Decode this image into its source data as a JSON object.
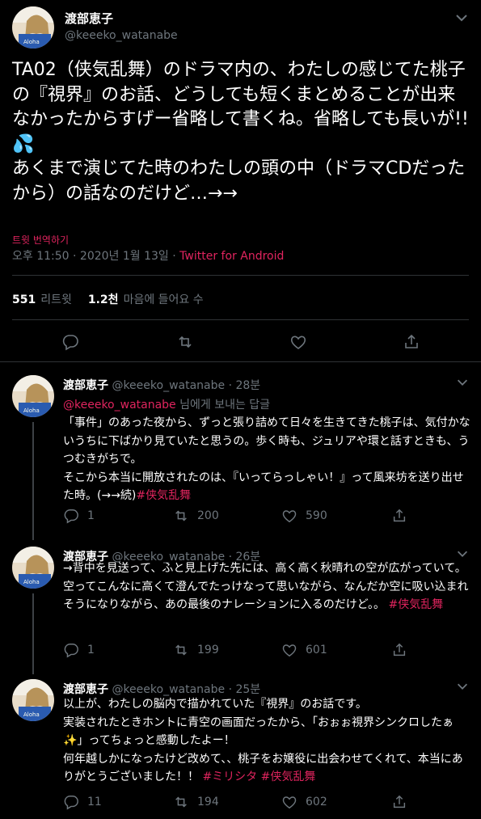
{
  "colors": {
    "accent": "#e0245e",
    "muted": "#6e767d",
    "divider": "#2f3336",
    "background": "#000000"
  },
  "main": {
    "author": "渡部恵子",
    "handle": "@keeeko_watanabe",
    "body": "TA02（侠気乱舞）のドラマ内の、わたしの感じてた桃子の『視界』のお話、どうしても短くまとめることが出来なかったからすげー省略して書くね。省略しても長いが!!💦\nあくまで演じてた時のわたしの頭の中（ドラマCDだったから）の話なのだけど…→→",
    "translate": "트윗 번역하기",
    "datetime": "오후 11:50 · 2020년 1월 13일",
    "sep": " · ",
    "source": "Twitter for Android",
    "retweets_count": "551",
    "retweets_label": "리트윗",
    "likes_count": "1.2천",
    "likes_label": "마음에 들어요 수",
    "icons": [
      "reply-icon",
      "retweet-icon",
      "like-icon",
      "share-icon"
    ]
  },
  "replies": [
    {
      "author": "渡部恵子",
      "handle": "@keeeko_watanabe · 28분",
      "replying_handle": "@keeeko_watanabe",
      "replying_suffix": " 님에게 보내는 답글",
      "text": "「事件」のあった夜から、ずっと張り詰めて日々を生きてきた桃子は、気付かないうちに下ばかり見ていたと思うの。歩く時も、ジュリアや環と話すときも、うつむきがちで。\nそこから本当に開放されたのは、『いってらっしゃい！』って風来坊を送り出せた時。(→→続)",
      "hashtags": "#侠気乱舞",
      "reply_count": "1",
      "retweet_count": "200",
      "like_count": "590"
    },
    {
      "author": "渡部恵子",
      "handle": "@keeeko_watanabe · 26분",
      "text": "→背中を見送って、ふと見上げた先には、高く高く秋晴れの空が広がっていて。空ってこんなに高くて澄んでたっけなって思いながら、なんだか空に吸い込まれそうになりながら、あの最後のナレーションに入るのだけど。。 ",
      "hashtags": "#侠気乱舞",
      "reply_count": "1",
      "retweet_count": "199",
      "like_count": "601"
    },
    {
      "author": "渡部恵子",
      "handle": "@keeeko_watanabe · 25분",
      "text": "以上が、わたしの脳内で描かれていた『視界』のお話です。\n実装されたときホントに青空の画面だったから、「おぉぉ視界シンクロしたぁ✨」ってちょっと感動したよー！\n何年越しかになったけど改めて、、桃子をお嬢役に出会わせてくれて、本当にありがとうございました！！ ",
      "hashtags": "#ミリシタ #侠気乱舞",
      "reply_count": "11",
      "retweet_count": "194",
      "like_count": "602"
    }
  ]
}
